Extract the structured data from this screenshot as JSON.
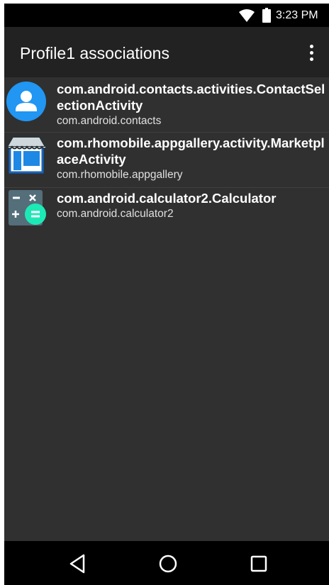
{
  "status_bar": {
    "time": "3:23 PM",
    "wifi_icon": "wifi-icon",
    "battery_icon": "battery-icon"
  },
  "app_bar": {
    "title": "Profile1 associations",
    "menu_icon": "more-vert-icon"
  },
  "associations": [
    {
      "title": "com.android.contacts.activities.ContactSelectionActivity",
      "package": "com.android.contacts",
      "icon": "contacts-icon"
    },
    {
      "title": "com.rhomobile.appgallery.activity.MarketplaceActivity",
      "package": "com.rhomobile.appgallery",
      "icon": "app-gallery-icon"
    },
    {
      "title": "com.android.calculator2.Calculator",
      "package": "com.android.calculator2",
      "icon": "calculator-icon"
    }
  ],
  "nav_bar": {
    "back_icon": "back-icon",
    "home_icon": "home-icon",
    "recents_icon": "recents-icon"
  },
  "colors": {
    "background": "#303030",
    "app_bar": "#222222",
    "status_bar": "#000000",
    "contacts_blue": "#2196f3",
    "calculator_green": "#1de9b6"
  }
}
